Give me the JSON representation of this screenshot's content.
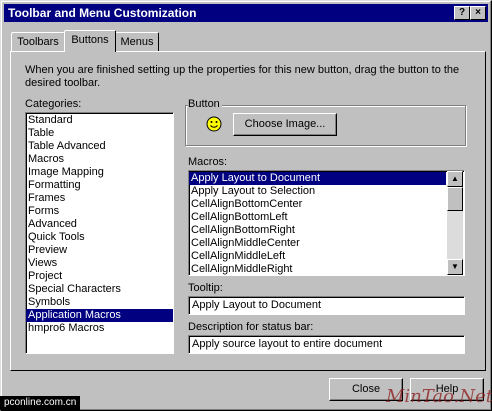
{
  "window": {
    "title": "Toolbar and Menu Customization",
    "close_glyph": "×",
    "help_glyph": "?"
  },
  "tabs": [
    {
      "label": "Toolbars",
      "active": false
    },
    {
      "label": "Buttons",
      "active": true
    },
    {
      "label": "Menus",
      "active": false
    }
  ],
  "instruction": "When you are finished setting up the properties for this new button, drag the button to the desired toolbar.",
  "categories": {
    "label": "Categories:",
    "items": [
      "Standard",
      "Table",
      "Table Advanced",
      "Macros",
      "Image Mapping",
      "Formatting",
      "Frames",
      "Forms",
      "Advanced",
      "Quick Tools",
      "Preview",
      "Views",
      "Project",
      "Special Characters",
      "Symbols",
      "Application Macros",
      "hmpro6 Macros"
    ],
    "selected": "Application Macros"
  },
  "button_group": {
    "label": "Button",
    "icon": "smiley-face-icon",
    "choose_image_label": "Choose Image..."
  },
  "macros": {
    "label": "Macros:",
    "items": [
      "Apply Layout to Document",
      "Apply Layout to Selection",
      "CellAlignBottomCenter",
      "CellAlignBottomLeft",
      "CellAlignBottomRight",
      "CellAlignMiddleCenter",
      "CellAlignMiddleLeft",
      "CellAlignMiddleRight"
    ],
    "selected": "Apply Layout to Document"
  },
  "tooltip": {
    "label": "Tooltip:",
    "value": "Apply Layout to Document"
  },
  "status_desc": {
    "label": "Description for status bar:",
    "value": "Apply source layout to entire document"
  },
  "footer": {
    "close_label": "Close",
    "help_label": "Help"
  },
  "watermarks": {
    "left": "pconline.com.cn",
    "right": "MinTao.Net"
  },
  "colors": {
    "title_bar": "#000080",
    "selection": "#000080",
    "dialog_face": "#c0c0c0",
    "smiley": "#ffff00"
  }
}
